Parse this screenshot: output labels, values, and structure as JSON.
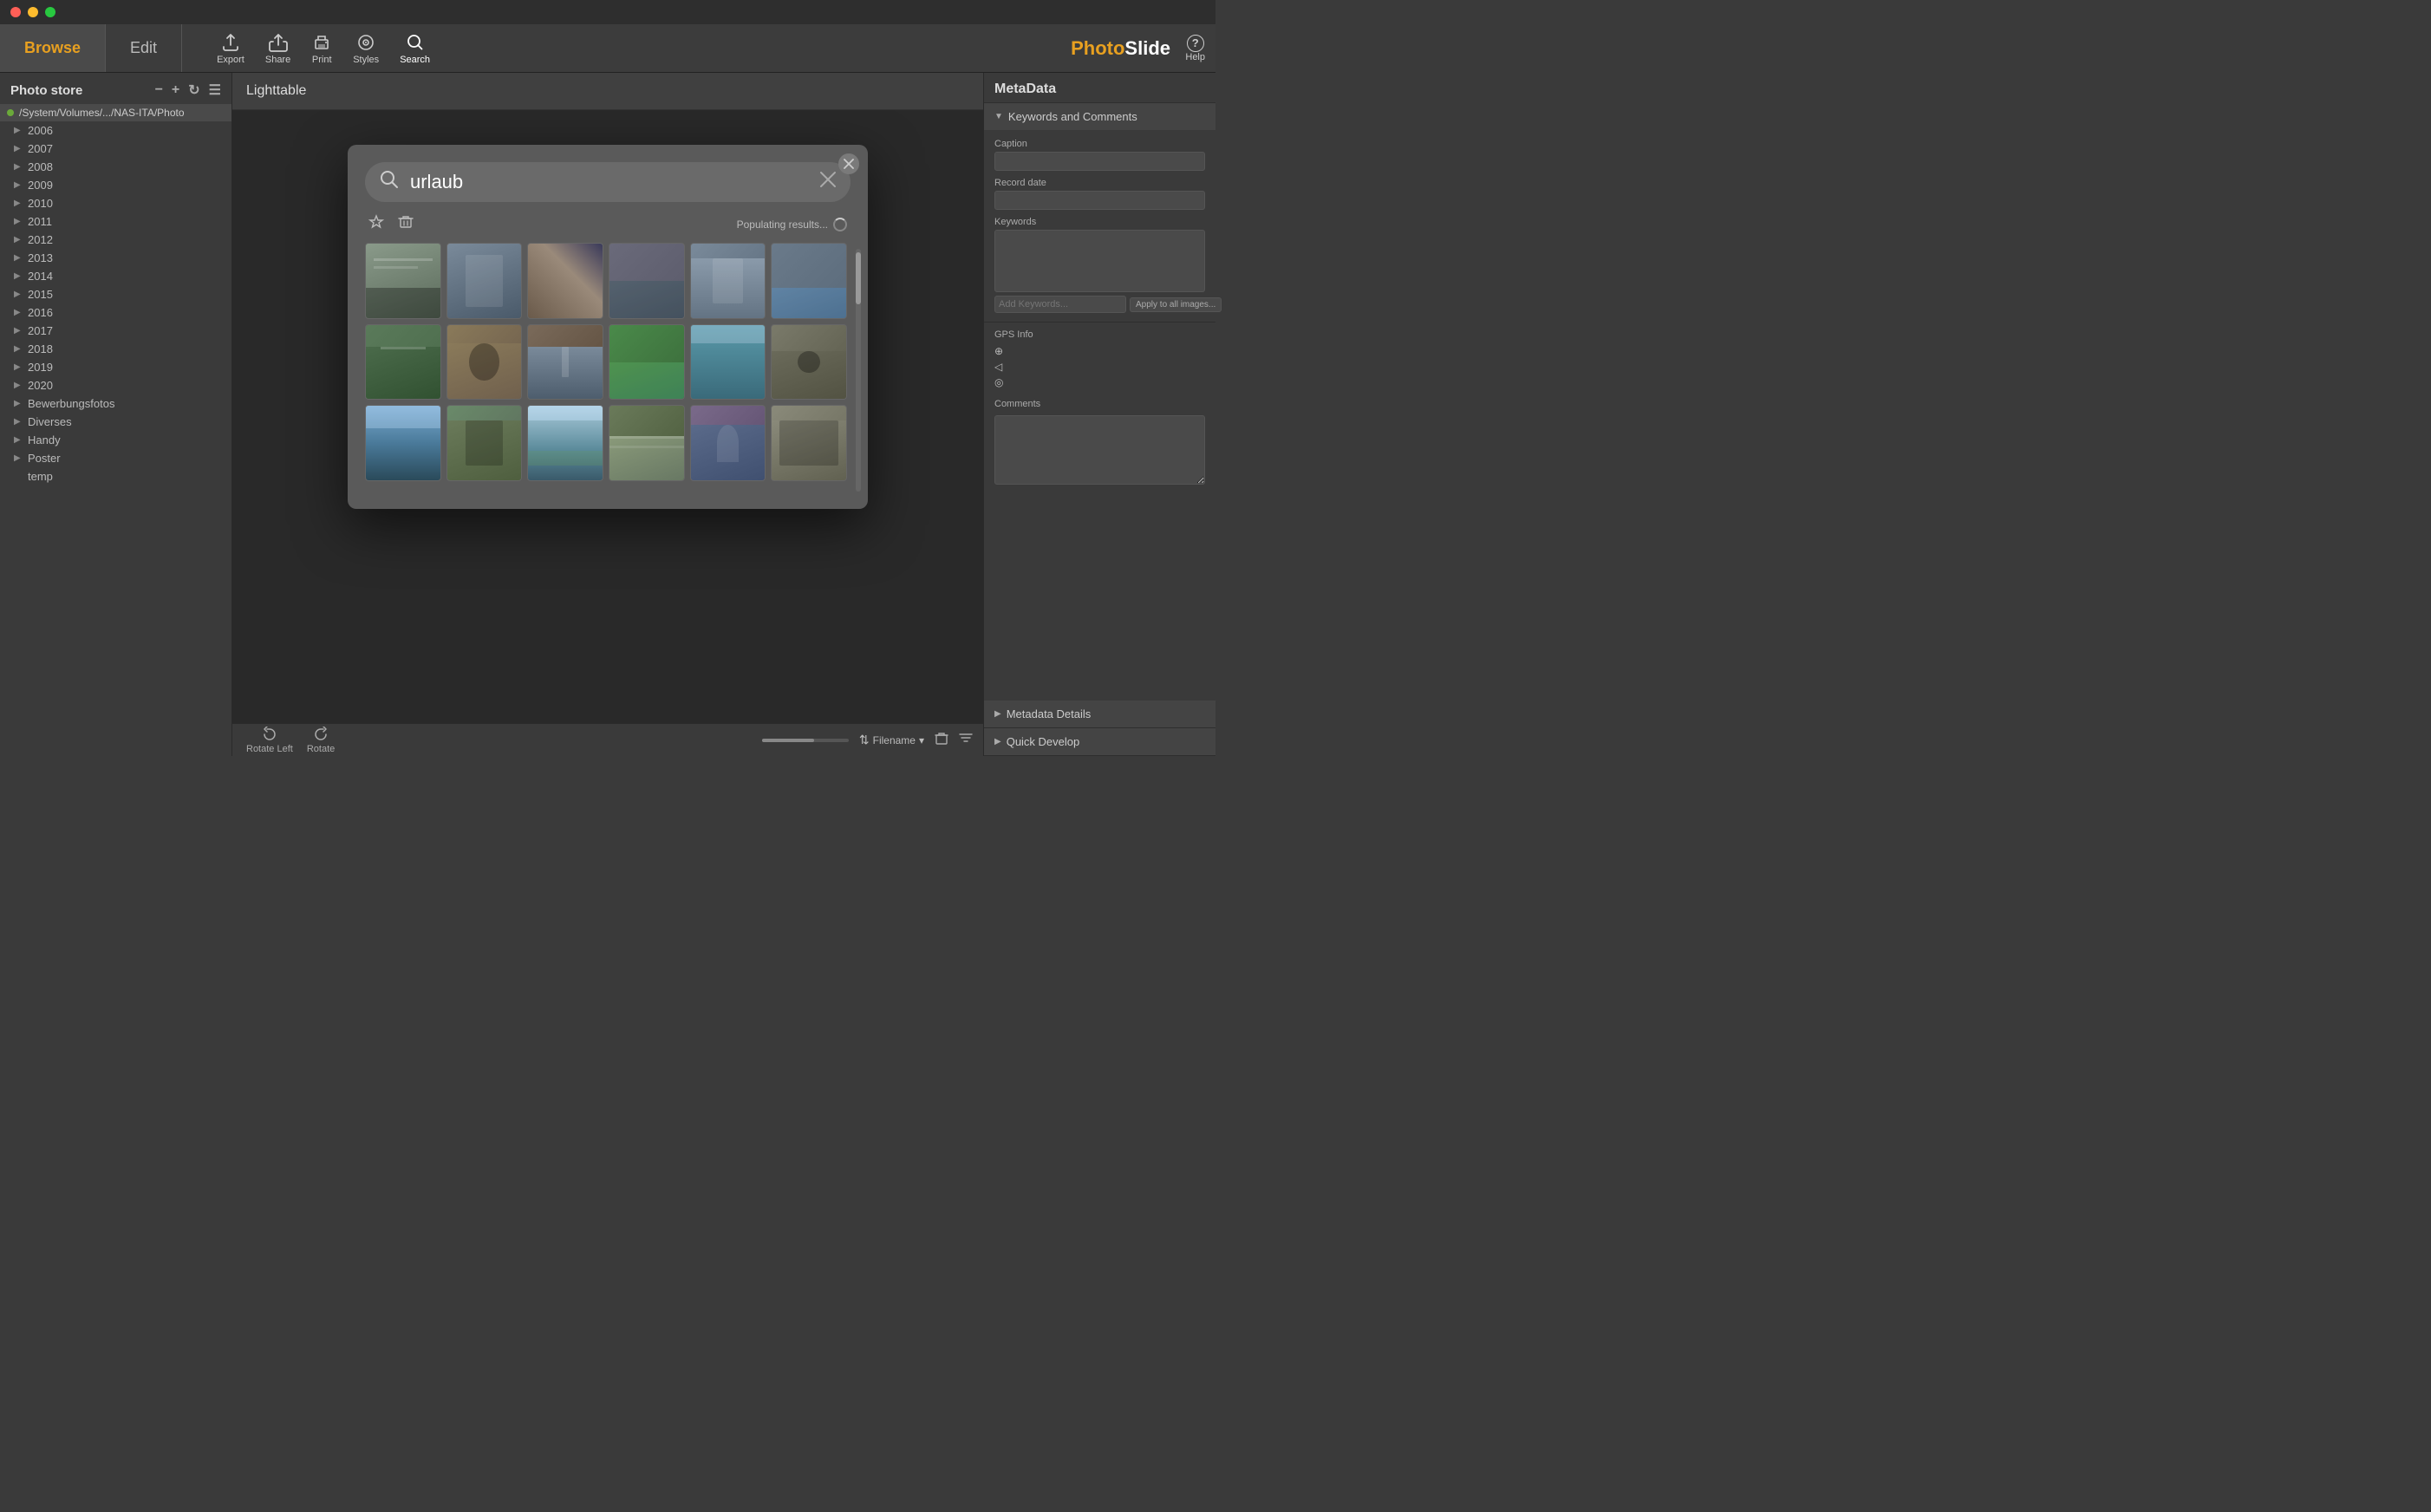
{
  "app": {
    "name": "PhotoSlide",
    "name_part1": "Photo",
    "name_part2": "Slide"
  },
  "titlebar": {
    "buttons": [
      "close",
      "minimize",
      "maximize"
    ]
  },
  "toolbar": {
    "tab_browse": "Browse",
    "tab_edit": "Edit",
    "export_label": "Export",
    "share_label": "Share",
    "print_label": "Print",
    "styles_label": "Styles",
    "search_label": "Search",
    "help_label": "Help"
  },
  "sidebar": {
    "title": "Photo store",
    "root_path": "/System/Volumes/.../NAS-ITA/Photo",
    "items": [
      {
        "label": "2006",
        "indent": 1
      },
      {
        "label": "2007",
        "indent": 1
      },
      {
        "label": "2008",
        "indent": 1
      },
      {
        "label": "2009",
        "indent": 1
      },
      {
        "label": "2010",
        "indent": 1
      },
      {
        "label": "2011",
        "indent": 1
      },
      {
        "label": "2012",
        "indent": 1
      },
      {
        "label": "2013",
        "indent": 1
      },
      {
        "label": "2014",
        "indent": 1
      },
      {
        "label": "2015",
        "indent": 1
      },
      {
        "label": "2016",
        "indent": 1
      },
      {
        "label": "2017",
        "indent": 1
      },
      {
        "label": "2018",
        "indent": 1
      },
      {
        "label": "2019",
        "indent": 1
      },
      {
        "label": "2020",
        "indent": 1
      },
      {
        "label": "Bewerbungsfotos",
        "indent": 1
      },
      {
        "label": "Diverses",
        "indent": 1
      },
      {
        "label": "Handy",
        "indent": 1
      },
      {
        "label": "Poster",
        "indent": 1
      },
      {
        "label": "temp",
        "indent": 1
      }
    ]
  },
  "lighttable": {
    "title": "Lighttable"
  },
  "bottom_bar": {
    "sort_label": "Filename",
    "rotate_left_label": "Rotate Left",
    "rotate_right_label": "Rotate"
  },
  "right_panel": {
    "metadata_title": "MetaData",
    "keywords_section": "Keywords and Comments",
    "caption_label": "Caption",
    "record_date_label": "Record date",
    "keywords_label": "Keywords",
    "add_keywords_placeholder": "Add Keywords...",
    "apply_btn": "Apply to all images...",
    "gps_label": "GPS Info",
    "comments_label": "Comments",
    "metadata_details": "Metadata Details",
    "quick_develop": "Quick Develop"
  },
  "search_dialog": {
    "search_value": "urlaub",
    "populating_text": "Populating results...",
    "thumbnails": [
      {
        "id": 1,
        "class": "thumb-1"
      },
      {
        "id": 2,
        "class": "thumb-2"
      },
      {
        "id": 3,
        "class": "thumb-3"
      },
      {
        "id": 4,
        "class": "thumb-4"
      },
      {
        "id": 5,
        "class": "thumb-5"
      },
      {
        "id": 6,
        "class": "thumb-6"
      },
      {
        "id": 7,
        "class": "thumb-7"
      },
      {
        "id": 8,
        "class": "thumb-8"
      },
      {
        "id": 9,
        "class": "thumb-9"
      },
      {
        "id": 10,
        "class": "thumb-10"
      },
      {
        "id": 11,
        "class": "thumb-11"
      },
      {
        "id": 12,
        "class": "thumb-12"
      },
      {
        "id": 13,
        "class": "thumb-13"
      },
      {
        "id": 14,
        "class": "thumb-14"
      },
      {
        "id": 15,
        "class": "thumb-15"
      },
      {
        "id": 16,
        "class": "thumb-16"
      },
      {
        "id": 17,
        "class": "thumb-17"
      },
      {
        "id": 18,
        "class": "thumb-18"
      }
    ]
  },
  "colors": {
    "accent_orange": "#e8a020",
    "bg_dark": "#2e2e2e",
    "bg_mid": "#3a3a3a",
    "bg_light": "#4a4a4a",
    "text_primary": "#ffffff",
    "text_secondary": "#cccccc",
    "text_muted": "#888888"
  }
}
